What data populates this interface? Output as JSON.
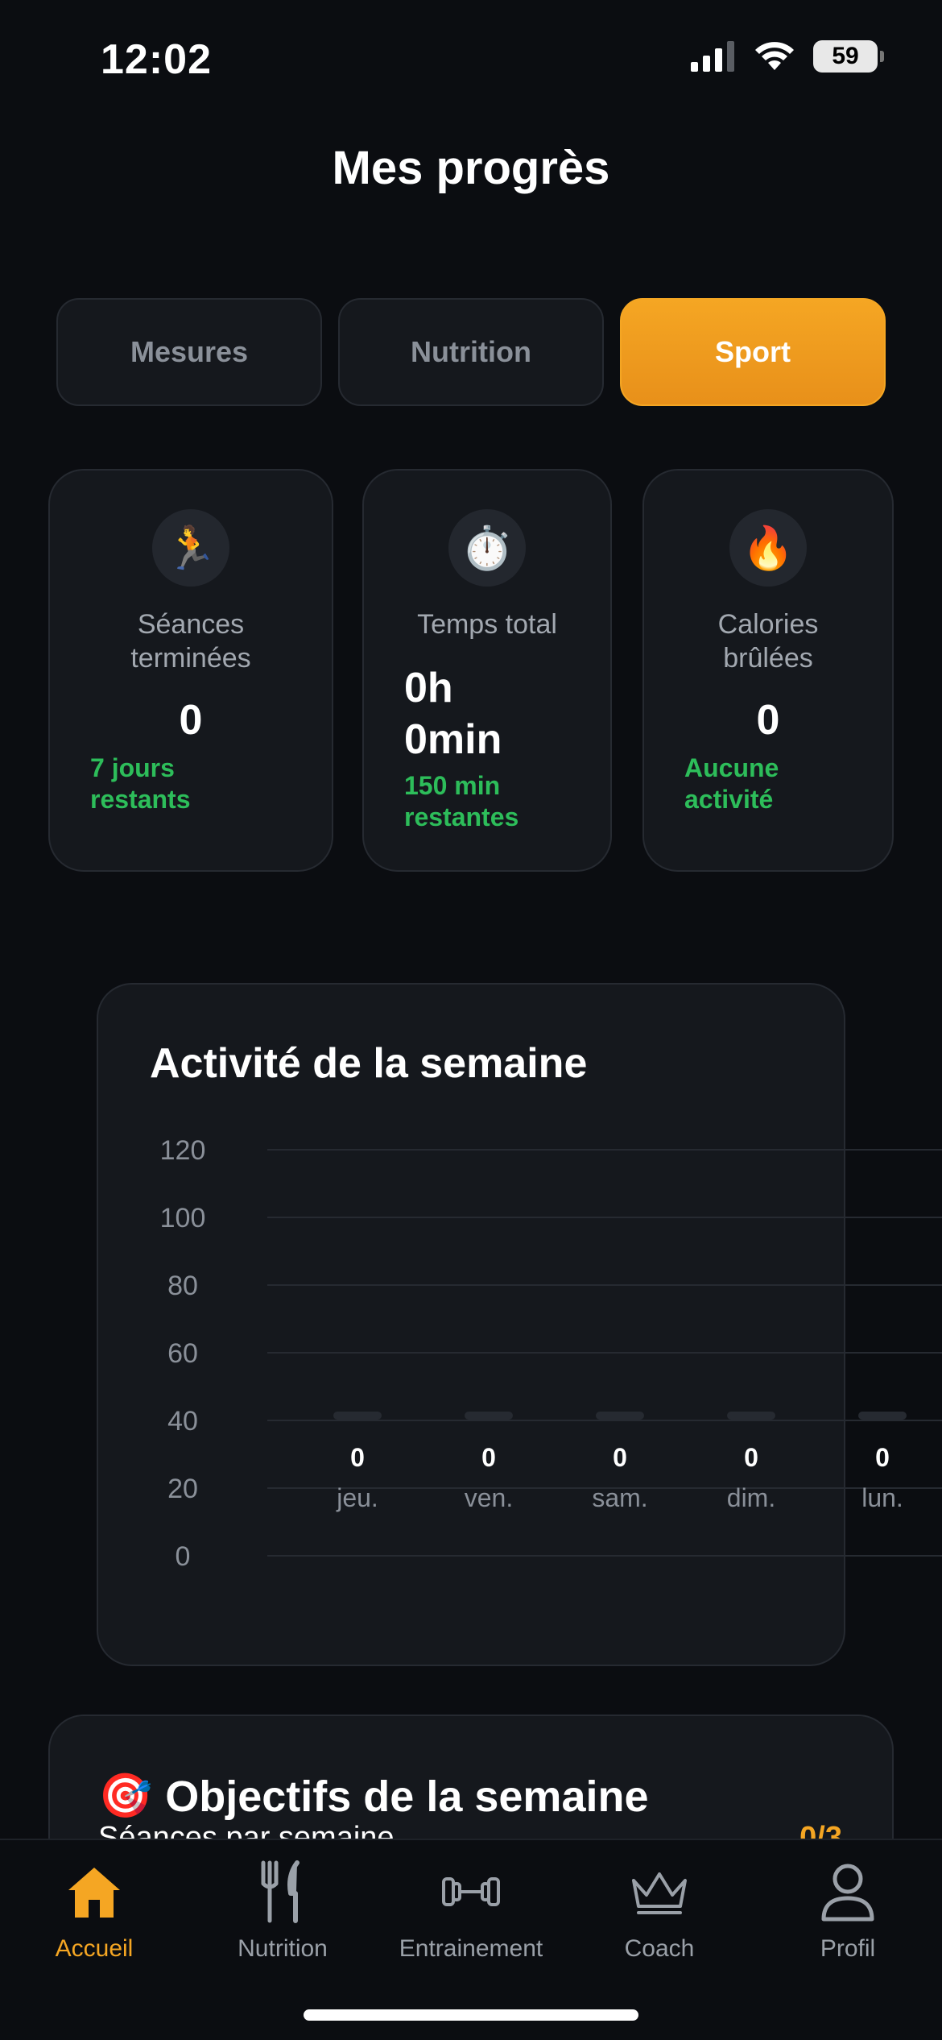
{
  "status_bar": {
    "time": "12:02",
    "battery": "59"
  },
  "page": {
    "title": "Mes progrès"
  },
  "tabs": [
    {
      "label": "Mesures",
      "active": false
    },
    {
      "label": "Nutrition",
      "active": false
    },
    {
      "label": "Sport",
      "active": true
    }
  ],
  "stats": [
    {
      "icon": "🏃",
      "icon_name": "runner-icon",
      "label": "Séances terminées",
      "value": "0",
      "sub": "7 jours restants"
    },
    {
      "icon": "⏱️",
      "icon_name": "stopwatch-icon",
      "label": "Temps total",
      "value": "0h 0min",
      "sub": "150 min restantes"
    },
    {
      "icon": "🔥",
      "icon_name": "fire-icon",
      "label": "Calories brûlées",
      "value": "0",
      "sub": "Aucune activité"
    }
  ],
  "chart_data": {
    "type": "bar",
    "title": "Activité de la semaine",
    "categories": [
      "jeu.",
      "ven.",
      "sam.",
      "dim.",
      "lun."
    ],
    "values": [
      0,
      0,
      0,
      0,
      0
    ],
    "y_ticks": [
      120,
      100,
      80,
      60,
      40,
      20,
      0
    ],
    "ylim": [
      0,
      120
    ],
    "grid": true
  },
  "objectives": {
    "icon": "🎯",
    "title": "Objectifs de la semaine",
    "row_label": "Séances par semaine",
    "row_value": "0/3"
  },
  "nav": [
    {
      "label": "Accueil",
      "icon_name": "home-icon",
      "active": true
    },
    {
      "label": "Nutrition",
      "icon_name": "fork-knife-icon",
      "active": false
    },
    {
      "label": "Entrainement",
      "icon_name": "dumbbell-icon",
      "active": false
    },
    {
      "label": "Coach",
      "icon_name": "crown-icon",
      "active": false
    },
    {
      "label": "Profil",
      "icon_name": "user-icon",
      "active": false
    }
  ],
  "colors": {
    "accent": "#f5a623",
    "success": "#2dbd5a",
    "card": "#15181d",
    "background": "#0b0d11"
  }
}
